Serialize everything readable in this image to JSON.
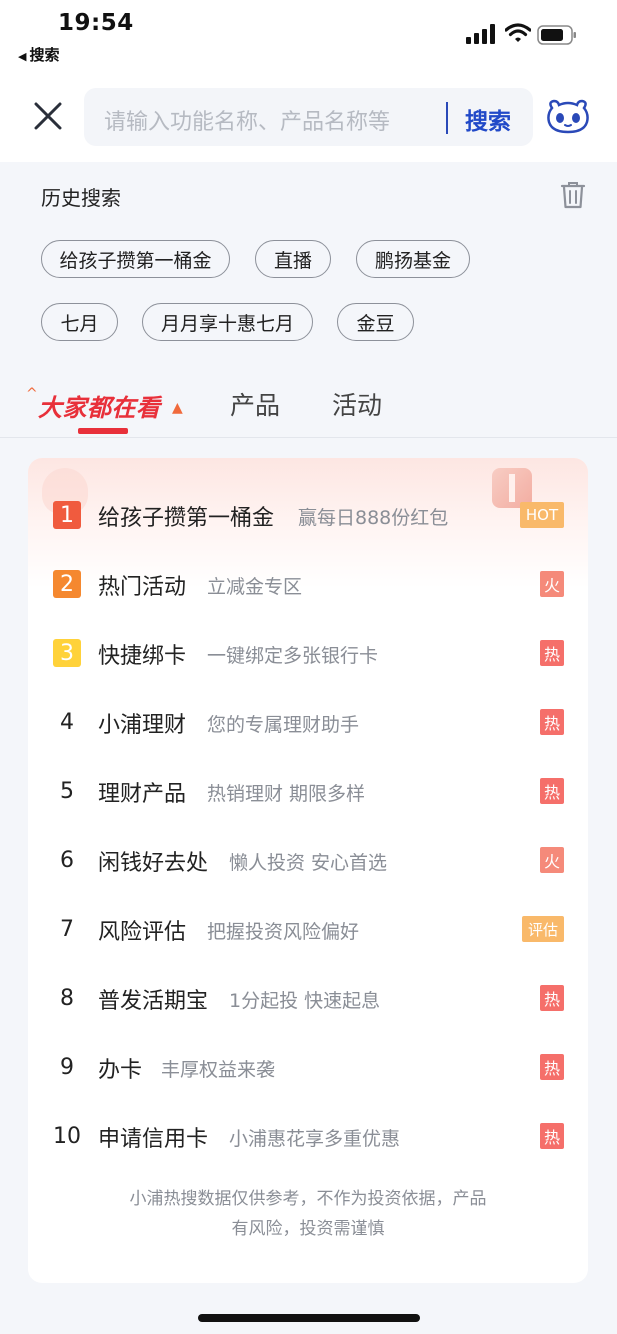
{
  "status_bar": {
    "time": "19:54",
    "back_app": "搜索"
  },
  "header": {
    "search_placeholder": "请输入功能名称、产品名称等",
    "search_button": "搜索",
    "close_icon": "close-icon",
    "mascot_icon": "panda-icon"
  },
  "history": {
    "title": "历史搜索",
    "chips": [
      "给孩子攒第一桶金",
      "直播",
      "鹏扬基金",
      "七月",
      "月月享十惠七月",
      "金豆"
    ]
  },
  "tabs": {
    "hot": "大家都在看",
    "product": "产品",
    "activity": "活动"
  },
  "ranking": [
    {
      "rank": "1",
      "title": "给孩子攒第一桶金",
      "subtitle": "赢每日888份红包",
      "badge": "HOT"
    },
    {
      "rank": "2",
      "title": "热门活动",
      "subtitle": "立减金专区",
      "badge": "火"
    },
    {
      "rank": "3",
      "title": "快捷绑卡",
      "subtitle": "一键绑定多张银行卡",
      "badge": "热"
    },
    {
      "rank": "4",
      "title": "小浦理财",
      "subtitle": "您的专属理财助手",
      "badge": "热"
    },
    {
      "rank": "5",
      "title": "理财产品",
      "subtitle": "热销理财 期限多样",
      "badge": "热"
    },
    {
      "rank": "6",
      "title": "闲钱好去处",
      "subtitle": "懒人投资 安心首选",
      "badge": "火"
    },
    {
      "rank": "7",
      "title": "风险评估",
      "subtitle": "把握投资风险偏好",
      "badge": "评估"
    },
    {
      "rank": "8",
      "title": "普发活期宝",
      "subtitle": "1分起投 快速起息",
      "badge": "热"
    },
    {
      "rank": "9",
      "title": "办卡",
      "subtitle": "丰厚权益来袭",
      "badge": "热"
    },
    {
      "rank": "10",
      "title": "申请信用卡",
      "subtitle": "小浦惠花享多重优惠",
      "badge": "热"
    }
  ],
  "disclaimer": "小浦热搜数据仅供参考，不作为投资依据，产品有风险，投资需谨慎",
  "colors": {
    "accent_red": "#e8303a",
    "link_blue": "#2149c8"
  }
}
